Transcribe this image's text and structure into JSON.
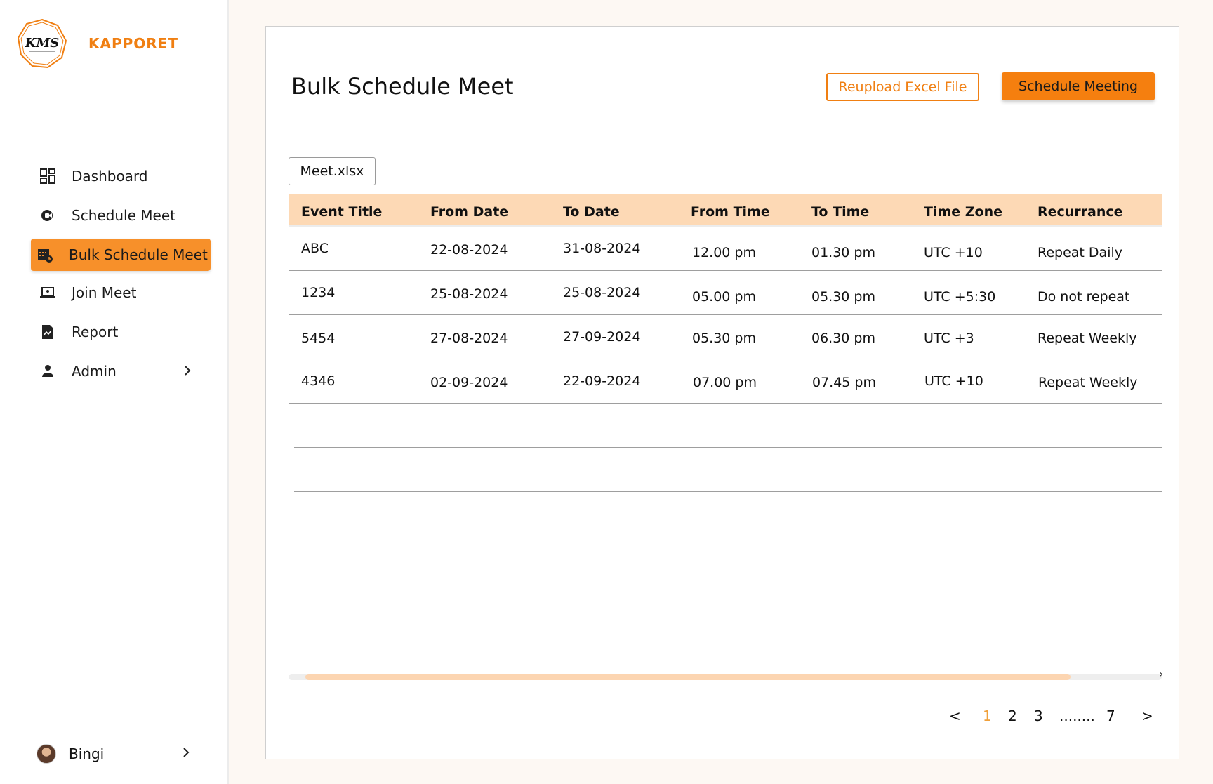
{
  "brand": {
    "name": "KAPPORET",
    "logo_text": "KMS",
    "accent": "#F07F12"
  },
  "sidebar": {
    "items": [
      {
        "label": "Dashboard",
        "icon": "dashboard-icon"
      },
      {
        "label": "Schedule Meet",
        "icon": "camera-icon"
      },
      {
        "label": "Bulk Schedule Meet",
        "icon": "calendar-icon",
        "active": true
      },
      {
        "label": "Join Meet",
        "icon": "laptop-icon"
      },
      {
        "label": "Report",
        "icon": "report-icon"
      },
      {
        "label": "Admin",
        "icon": "person-icon",
        "has_chevron": true
      }
    ],
    "user": {
      "name": "Bingi"
    }
  },
  "page": {
    "title": "Bulk Schedule Meet",
    "reupload_label": "Reupload Excel File",
    "schedule_label": "Schedule Meeting",
    "file_name": "Meet.xlsx"
  },
  "table": {
    "columns": [
      "Event Title",
      "From Date",
      "To Date",
      "From Time",
      "To Time",
      "Time Zone",
      "Recurrance"
    ],
    "rows": [
      [
        "ABC",
        "22-08-2024",
        "31-08-2024",
        "12.00 pm",
        "01.30 pm",
        "UTC +10",
        "Repeat Daily"
      ],
      [
        "1234",
        "25-08-2024",
        "25-08-2024",
        "05.00 pm",
        "05.30 pm",
        "UTC +5:30",
        "Do not repeat"
      ],
      [
        "5454",
        "27-08-2024",
        "27-09-2024",
        "05.30 pm",
        "06.30 pm",
        "UTC +3",
        "Repeat Weekly"
      ],
      [
        "4346",
        "02-09-2024",
        "22-09-2024",
        "07.00 pm",
        "07.45 pm",
        "UTC +10",
        "Repeat Weekly"
      ]
    ]
  },
  "pagination": {
    "prev": "<",
    "pages": [
      "1",
      "2",
      "3"
    ],
    "ellipsis": "........",
    "last": "7",
    "next": ">",
    "current": "1"
  },
  "scrollbar": {
    "arrow": "›"
  }
}
